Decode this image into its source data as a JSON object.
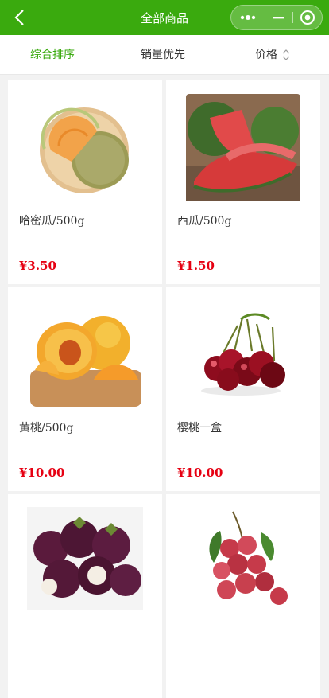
{
  "header": {
    "title": "全部商品"
  },
  "sort": {
    "tabs": [
      {
        "label": "综合排序"
      },
      {
        "label": "销量优先"
      },
      {
        "label": "价格"
      }
    ]
  },
  "products": [
    {
      "name": "哈密瓜/500g",
      "price": "¥3.50",
      "image_icon": "cantaloupe-icon"
    },
    {
      "name": "西瓜/500g",
      "price": "¥1.50",
      "image_icon": "watermelon-icon"
    },
    {
      "name": "黄桃/500g",
      "price": "¥10.00",
      "image_icon": "peach-icon"
    },
    {
      "name": "樱桃一盒",
      "price": "¥10.00",
      "image_icon": "cherry-icon"
    },
    {
      "name": "",
      "price": "",
      "image_icon": "mangosteen-icon"
    },
    {
      "name": "",
      "price": "",
      "image_icon": "lychee-icon"
    }
  ],
  "colors": {
    "brand": "#3aaa0e",
    "price": "#e60012",
    "active_tab": "#3aaa0e"
  }
}
